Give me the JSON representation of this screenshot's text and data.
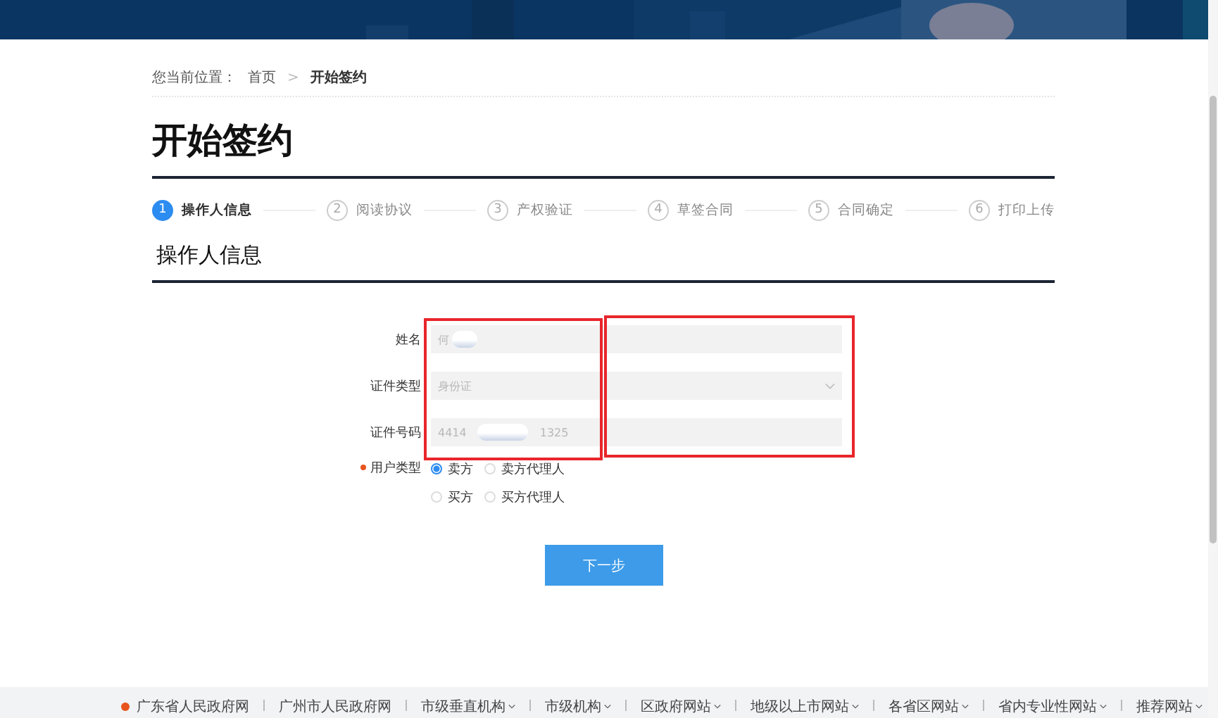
{
  "breadcrumb": {
    "label": "您当前位置：",
    "items": [
      {
        "text": "首页",
        "current": false
      },
      {
        "text": "开始签约",
        "current": true
      }
    ],
    "separator": ">"
  },
  "page_title": "开始签约",
  "steps": [
    {
      "number": "1",
      "label": "操作人信息",
      "selected": true
    },
    {
      "number": "2",
      "label": "阅读协议",
      "selected": false
    },
    {
      "number": "3",
      "label": "产权验证",
      "selected": false
    },
    {
      "number": "4",
      "label": "草签合同",
      "selected": false
    },
    {
      "number": "5",
      "label": "合同确定",
      "selected": false
    },
    {
      "number": "6",
      "label": "打印上传",
      "selected": false
    }
  ],
  "section_title": "操作人信息",
  "form": {
    "fields": [
      {
        "kind": "text",
        "label": "姓名",
        "value": "何",
        "disabled": true
      },
      {
        "kind": "select",
        "label": "证件类型",
        "value": "身份证",
        "disabled": true
      },
      {
        "kind": "id",
        "label": "证件号码",
        "value": "4414",
        "value_end": "1325",
        "disabled": true
      }
    ],
    "user_type": {
      "label": "用户类型",
      "required": true,
      "options": [
        {
          "label": "卖方",
          "selected": true
        },
        {
          "label": "卖方代理人",
          "selected": false
        },
        {
          "label": "买方",
          "selected": false
        },
        {
          "label": "买方代理人",
          "selected": false
        }
      ]
    },
    "submit": "下一步"
  },
  "footer_links": [
    {
      "text": "广东省人民政府网",
      "dropdown": false,
      "dot": true
    },
    {
      "text": "广州市人民政府网",
      "dropdown": false,
      "dot": false
    },
    {
      "text": "市级垂直机构",
      "dropdown": true,
      "dot": false
    },
    {
      "text": "市级机构",
      "dropdown": true,
      "dot": false
    },
    {
      "text": "区政府网站",
      "dropdown": true,
      "dot": false
    },
    {
      "text": "地级以上市网站",
      "dropdown": true,
      "dot": false
    },
    {
      "text": "各省区网站",
      "dropdown": true,
      "dot": false
    },
    {
      "text": "省内专业性网站",
      "dropdown": true,
      "dot": false
    },
    {
      "text": "推荐网站",
      "dropdown": true,
      "dot": false
    }
  ]
}
